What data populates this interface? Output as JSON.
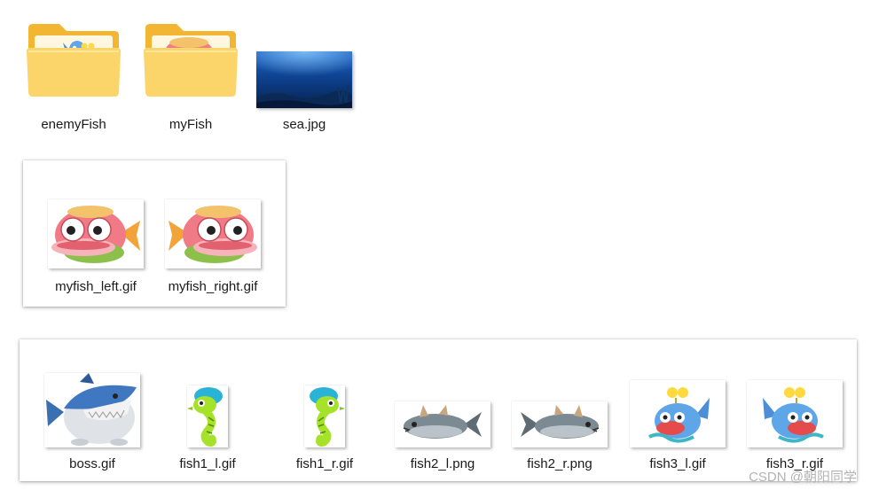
{
  "top_files": [
    {
      "name": "enemyFish"
    },
    {
      "name": "myFish"
    },
    {
      "name": "sea.jpg"
    }
  ],
  "myfish_files": [
    {
      "name": "myfish_left.gif"
    },
    {
      "name": "myfish_right.gif"
    }
  ],
  "enemy_files": [
    {
      "name": "boss.gif"
    },
    {
      "name": "fish1_l.gif"
    },
    {
      "name": "fish1_r.gif"
    },
    {
      "name": "fish2_l.png"
    },
    {
      "name": "fish2_r.png"
    },
    {
      "name": "fish3_l.gif"
    },
    {
      "name": "fish3_r.gif"
    }
  ],
  "watermark": "CSDN @朝阳同学",
  "colors": {
    "folder_back": "#f2b632",
    "folder_front": "#fcd56a",
    "label_text": "#1a1a1a",
    "watermark": "#b3b3b3"
  }
}
